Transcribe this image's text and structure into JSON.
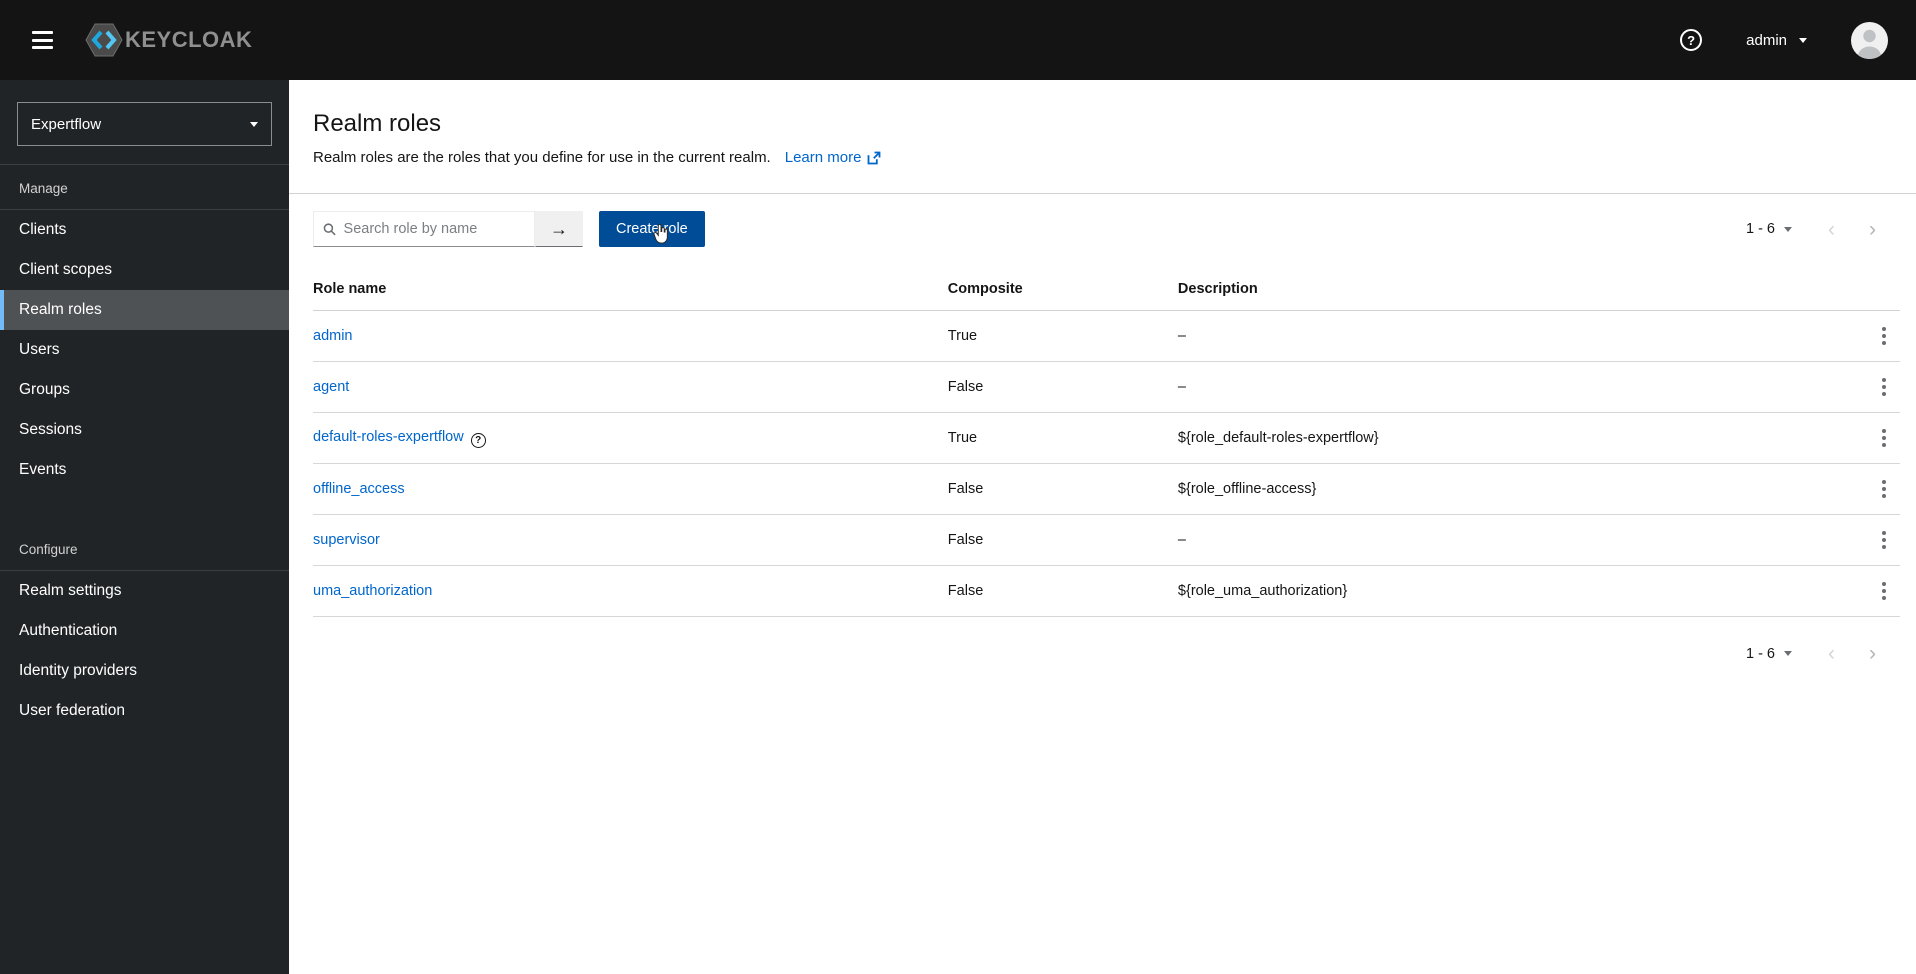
{
  "colors": {
    "accent": "#0066cc",
    "primary_btn": "#004c96",
    "nav_indicator": "#73bcf7"
  },
  "header": {
    "brand": "KEYCLOAK",
    "username": "admin"
  },
  "sidebar": {
    "realm": "Expertflow",
    "selected_item": "Realm roles",
    "groups": [
      {
        "label": "Manage",
        "items": [
          "Clients",
          "Client scopes",
          "Realm roles",
          "Users",
          "Groups",
          "Sessions",
          "Events"
        ]
      },
      {
        "label": "Configure",
        "items": [
          "Realm settings",
          "Authentication",
          "Identity providers",
          "User federation"
        ]
      }
    ]
  },
  "page": {
    "title": "Realm roles",
    "subtitle": "Realm roles are the roles that you define for use in the current realm.",
    "learn_more": "Learn more"
  },
  "toolbar": {
    "search_placeholder": "Search role by name",
    "create_label": "Create role"
  },
  "pagination": {
    "range": "1 - 6"
  },
  "table": {
    "columns": [
      "Role name",
      "Composite",
      "Description"
    ],
    "rows": [
      {
        "name": "admin",
        "composite": "True",
        "description": "–",
        "has_help": false
      },
      {
        "name": "agent",
        "composite": "False",
        "description": "–",
        "has_help": false
      },
      {
        "name": "default-roles-expertflow",
        "composite": "True",
        "description": "${role_default-roles-expertflow}",
        "has_help": true
      },
      {
        "name": "offline_access",
        "composite": "False",
        "description": "${role_offline-access}",
        "has_help": false
      },
      {
        "name": "supervisor",
        "composite": "False",
        "description": "–",
        "has_help": false
      },
      {
        "name": "uma_authorization",
        "composite": "False",
        "description": "${role_uma_authorization}",
        "has_help": false
      }
    ]
  }
}
